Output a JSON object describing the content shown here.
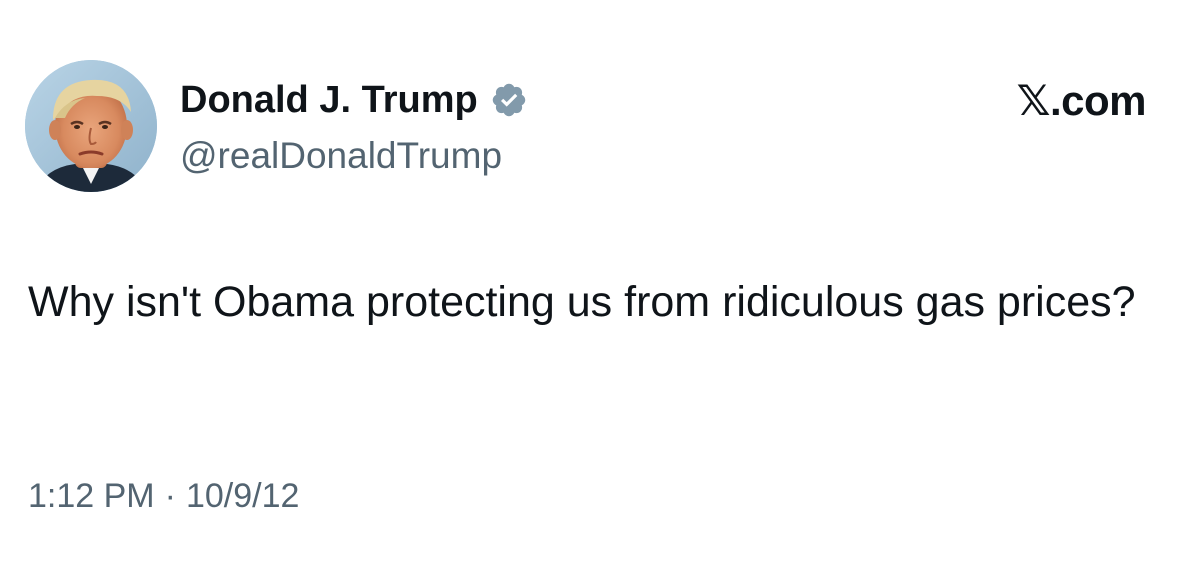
{
  "author": {
    "display_name": "Donald J. Trump",
    "handle": "@realDonaldTrump",
    "verified": true,
    "verified_badge_color": "#829aab",
    "avatar_icon": "profile-photo"
  },
  "brand": {
    "label": "𝕏.com"
  },
  "tweet": {
    "text": "Why isn't Obama protecting us from ridiculous gas prices?",
    "time": "1:12 PM",
    "separator": "·",
    "date": "10/9/12"
  },
  "colors": {
    "text_primary": "#0f1419",
    "text_secondary": "#536471",
    "background": "#ffffff"
  }
}
